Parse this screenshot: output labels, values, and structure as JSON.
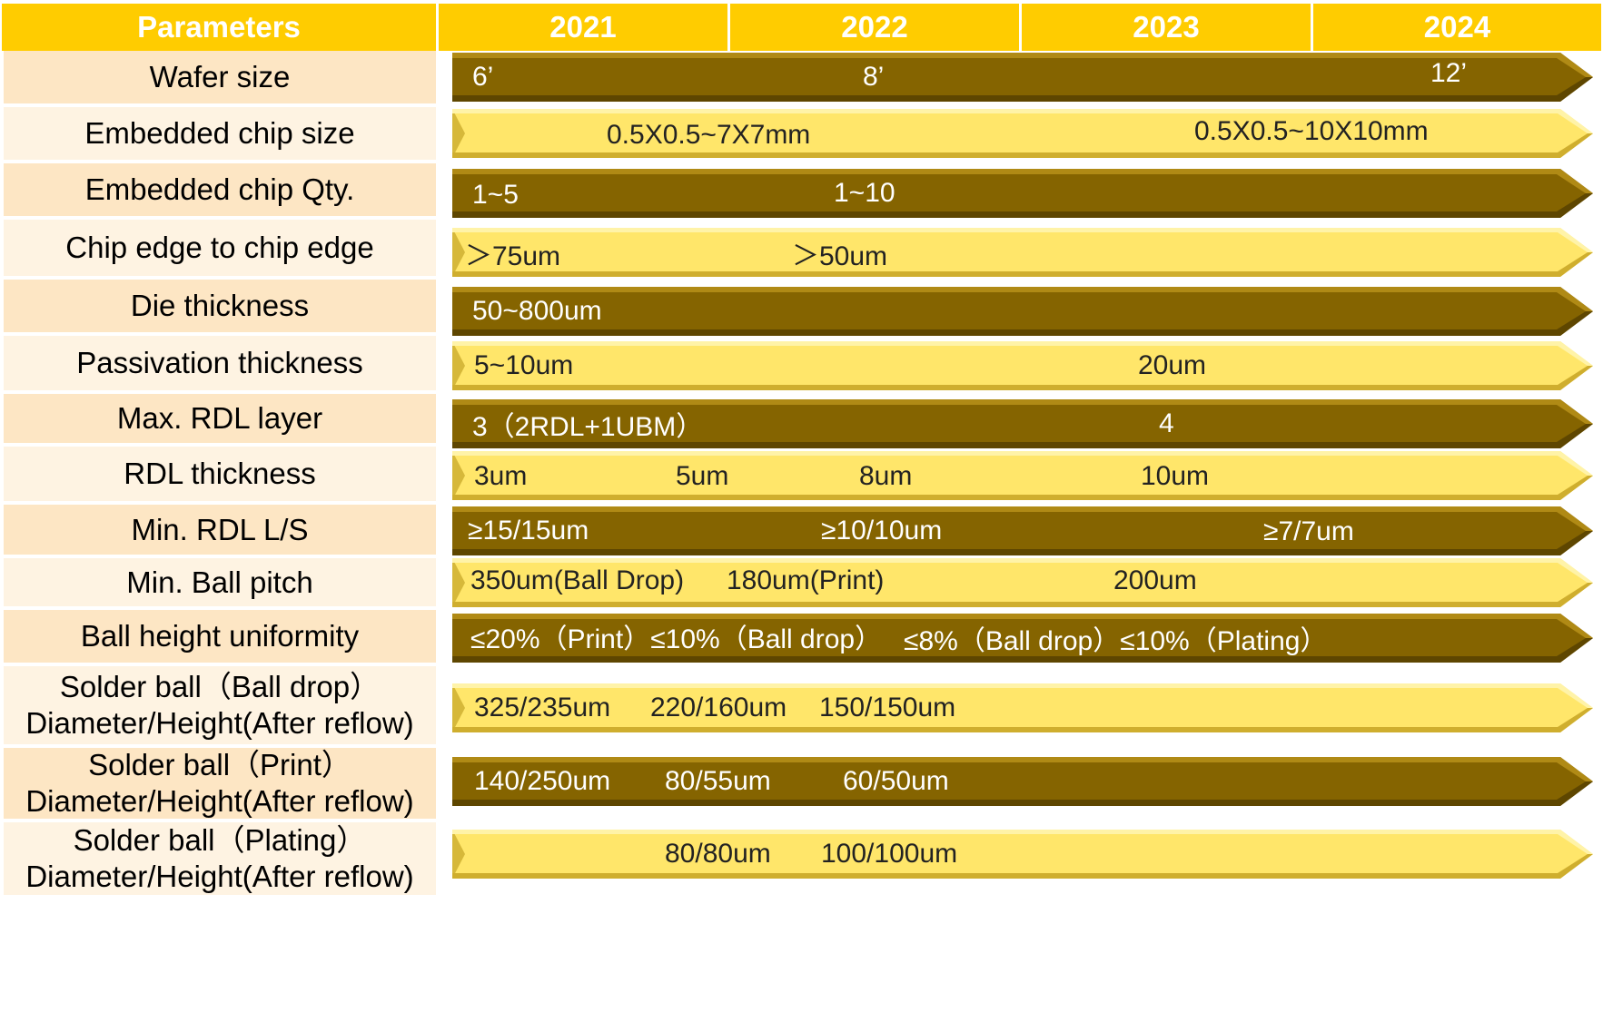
{
  "header": {
    "parameters": "Parameters",
    "years": [
      "2021",
      "2022",
      "2023",
      "2024"
    ]
  },
  "colors": {
    "header": "#ffcc00",
    "dark_arrow": "#856400",
    "light_arrow": "#ffe66a",
    "param_odd": "#fde6c4",
    "param_even": "#fef3e2"
  },
  "rows": [
    {
      "param": "Wafer size",
      "style": "dark",
      "labels": [
        "6’",
        "8’",
        "12’"
      ]
    },
    {
      "param": "Embedded chip size",
      "style": "light",
      "labels": [
        "0.5X0.5~7X7mm",
        "0.5X0.5~10X10mm"
      ]
    },
    {
      "param": "Embedded chip Qty.",
      "style": "dark",
      "labels": [
        "1~5",
        "1~10"
      ]
    },
    {
      "param": "Chip edge to chip edge",
      "style": "light",
      "labels": [
        "＞75um",
        "＞50um"
      ]
    },
    {
      "param": "Die thickness",
      "style": "dark",
      "labels": [
        "50~800um"
      ]
    },
    {
      "param": "Passivation thickness",
      "style": "light",
      "labels": [
        "5~10um",
        "20um"
      ]
    },
    {
      "param": "Max. RDL layer",
      "style": "dark",
      "labels": [
        "3（2RDL+1UBM）",
        "4"
      ]
    },
    {
      "param": "RDL thickness",
      "style": "light",
      "labels": [
        "3um",
        "5um",
        "8um",
        "10um"
      ]
    },
    {
      "param": "Min. RDL L/S",
      "style": "dark",
      "labels": [
        "≥15/15um",
        "≥10/10um",
        "≥7/7um"
      ]
    },
    {
      "param": "Min. Ball pitch",
      "style": "light",
      "labels": [
        "350um(Ball Drop)",
        "180um(Print)",
        "200um"
      ]
    },
    {
      "param": "Ball height uniformity",
      "style": "dark",
      "labels": [
        "≤20%（Print）≤10%（Ball drop）",
        "≤8%（Ball drop）≤10%（Plating）"
      ]
    },
    {
      "param": "Solder ball（Ball drop）\nDiameter/Height(After reflow)",
      "style": "light",
      "labels": [
        "325/235um",
        "220/160um",
        "150/150um"
      ]
    },
    {
      "param": "Solder ball（Print）\nDiameter/Height(After reflow)",
      "style": "dark",
      "labels": [
        "140/250um",
        "80/55um",
        "60/50um"
      ]
    },
    {
      "param": "Solder ball（Plating）\nDiameter/Height(After reflow)",
      "style": "light",
      "labels": [
        "80/80um",
        "100/100um"
      ]
    }
  ]
}
